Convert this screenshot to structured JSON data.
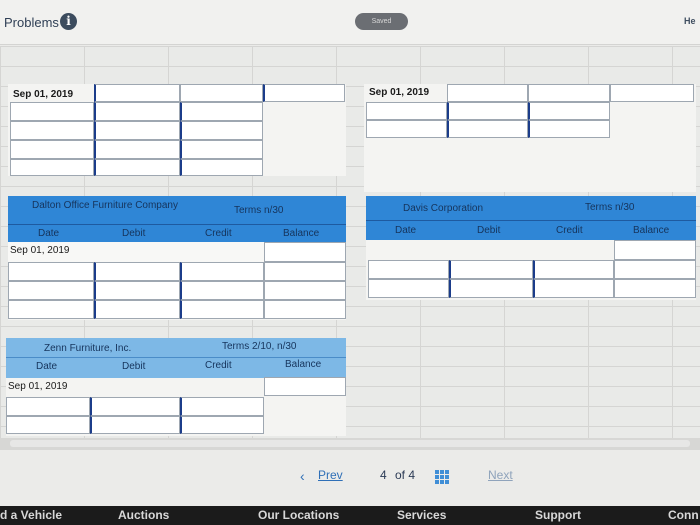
{
  "header": {
    "title": "Problems",
    "info_icon": "i",
    "saved": "Saved",
    "help": "He"
  },
  "sections": {
    "top_left": {
      "date": "Sep 01, 2019"
    },
    "top_right": {
      "date": "Sep 01, 2019"
    },
    "dalton": {
      "name": "Dalton Office Furniture Company",
      "terms": "Terms n/30",
      "cols": [
        "Date",
        "Debit",
        "Credit",
        "Balance"
      ],
      "date": "Sep 01, 2019"
    },
    "davis": {
      "name": "Davis Corporation",
      "terms": "Terms n/30",
      "cols": [
        "Date",
        "Debit",
        "Credit",
        "Balance"
      ]
    },
    "zenn": {
      "name": "Zenn Furniture, Inc.",
      "terms": "Terms 2/10, n/30",
      "cols": [
        "Date",
        "Debit",
        "Credit",
        "Balance"
      ],
      "date": "Sep 01, 2019"
    }
  },
  "pager": {
    "prev": "Prev",
    "page": "4",
    "of": "of 4",
    "next": "Next"
  },
  "footer": [
    "d a Vehicle",
    "Auctions",
    "Our Locations",
    "Services",
    "Support",
    "Conn"
  ]
}
